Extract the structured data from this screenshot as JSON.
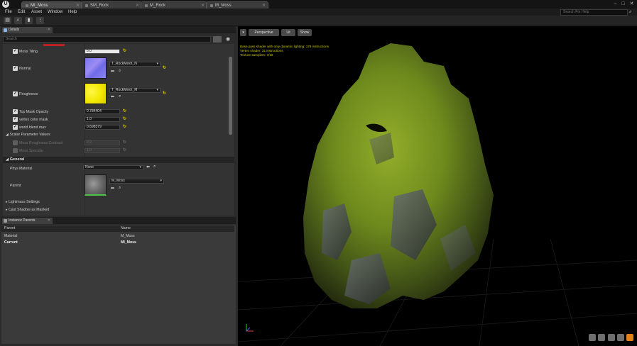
{
  "window": {
    "tabs": [
      {
        "label": "MI_Moss",
        "active": true
      },
      {
        "label": "SM_Rock",
        "active": false
      },
      {
        "label": "M_Rock",
        "active": false
      },
      {
        "label": "M_Moss",
        "active": false
      }
    ],
    "controls": {
      "minimize": "–",
      "maximize": "□",
      "close": "✕"
    }
  },
  "menu": {
    "items": [
      "File",
      "Edit",
      "Asset",
      "Window",
      "Help"
    ],
    "search_placeholder": "Search For Help"
  },
  "details": {
    "tab_label": "Details",
    "search_placeholder": "Search",
    "properties": {
      "moss_tiling": {
        "label": "Moss Tiling",
        "value": "5.0"
      },
      "normal": {
        "label": "Normal",
        "texture": "T_RockMesh_N"
      },
      "roughness": {
        "label": "Roughness",
        "texture": "T_RockMesh_M"
      },
      "top_mask_opacity": {
        "label": "Top Mask Opacity",
        "value": "0.784404"
      },
      "vertex_color_mask": {
        "label": "vertex color mask",
        "value": "1.0"
      },
      "world_blend_max": {
        "label": "world blend max",
        "value": "0.698379"
      }
    },
    "scalar_group": {
      "label": "Scalar Parameter Values",
      "moss_roughness_contrast": {
        "label": "Moss Roughness Contrast",
        "value": "0.2"
      },
      "moss_specular": {
        "label": "Moss Specular",
        "value": "1.0"
      }
    },
    "general": {
      "header": "General",
      "phys_material": {
        "label": "Phys Material",
        "value": "None"
      },
      "parent": {
        "label": "Parent",
        "value": "M_Moss"
      }
    },
    "lightmass": {
      "label": "Lightmass Settings"
    },
    "cast_shadow": {
      "label": "Cast Shadow as Masked"
    }
  },
  "instance_parents": {
    "tab_label": "Instance Parents",
    "columns": [
      "Parent",
      "Name"
    ],
    "rows": [
      {
        "parent": "Material",
        "name": "M_Moss",
        "bold": false
      },
      {
        "parent": "Current",
        "name": "MI_Moss",
        "bold": true
      }
    ]
  },
  "viewport": {
    "perspective_label": "Perspective",
    "lit_label": "Lit",
    "show_label": "Show",
    "stats": [
      "Base pass shader with only dynamic lighting: 178 instructions",
      "Vertex shader: 31 instructions",
      "Texture samplers: 7/16"
    ],
    "colors": {
      "moss": "#6f8a1c",
      "rock": "#4a4f4f",
      "stats_text": "#c8c800"
    }
  }
}
